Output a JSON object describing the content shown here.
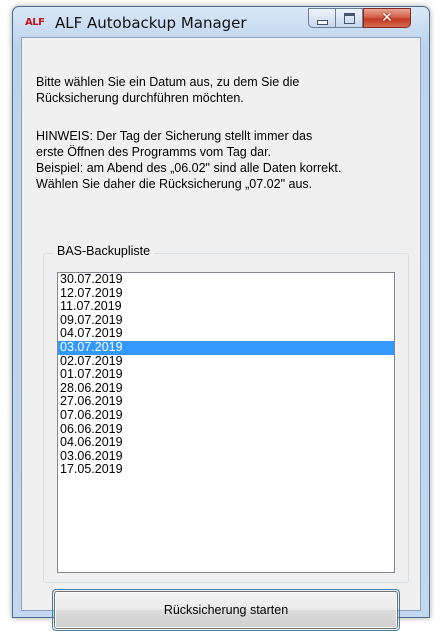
{
  "window": {
    "logo_text": "ALF",
    "title": "ALF Autobackup Manager",
    "close_glyph": "✕"
  },
  "message": {
    "line1": "Bitte wählen Sie ein Datum aus, zu dem Sie die",
    "line2": "Rücksicherung durchführen möchten.",
    "hint1": "HINWEIS: Der Tag der Sicherung stellt immer das",
    "hint2": "erste Öffnen des Programms vom Tag dar.",
    "hint3": "Beispiel: am Abend des „06.02\" sind alle Daten korrekt.",
    "hint4": "Wählen Sie daher die Rücksicherung „07.02\" aus."
  },
  "backup_list": {
    "label": "BAS-Backupliste",
    "items": [
      "30.07.2019",
      "12.07.2019",
      "11.07.2019",
      "09.07.2019",
      "04.07.2019",
      "03.07.2019",
      "02.07.2019",
      "01.07.2019",
      "28.06.2019",
      "27.06.2019",
      "07.06.2019",
      "06.06.2019",
      "04.06.2019",
      "03.06.2019",
      "17.05.2019"
    ],
    "selected": "03.07.2019"
  },
  "actions": {
    "restore_label": "Rücksicherung starten"
  },
  "colors": {
    "selection": "#3399ff",
    "logo": "#c0181b"
  }
}
